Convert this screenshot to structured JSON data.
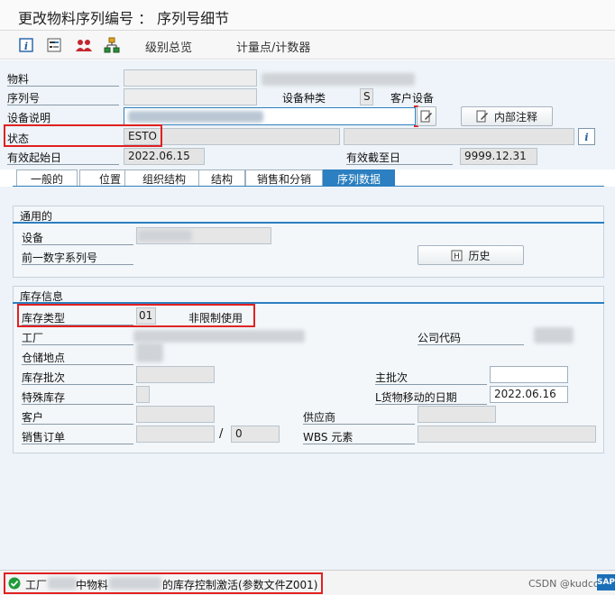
{
  "window": {
    "title": "更改物料序列编号 ： 序列号细节"
  },
  "toolbar": {
    "icons": [
      "info-icon",
      "structure-icon",
      "partners-icon",
      "hierarchy-icon"
    ],
    "overview_label": "级别总览",
    "counter_label": "计量点/计数器"
  },
  "header": {
    "material_label": "物料",
    "serial_label": "序列号",
    "equip_category_label": "设备种类",
    "equip_category_value": "S",
    "equip_category_text": "客户设备",
    "description_label": "设备说明",
    "internal_note_label": "内部注释",
    "status_label": "状态",
    "status_value": "ESTO",
    "valid_from_label": "有效起始日",
    "valid_from_value": "2022.06.15",
    "valid_to_label": "有效截至日",
    "valid_to_value": "9999.12.31"
  },
  "tabs": [
    {
      "label": "一般的"
    },
    {
      "label": "位置"
    },
    {
      "label": "组织结构"
    },
    {
      "label": "结构"
    },
    {
      "label": "销售和分销"
    },
    {
      "label": "序列数据"
    }
  ],
  "general_group": {
    "title": "通用的",
    "equipment_label": "设备",
    "prev_serial_label": "前一数字系列号",
    "history_button": "历史"
  },
  "stock_group": {
    "title": "库存信息",
    "stock_type_label": "库存类型",
    "stock_type_value": "01",
    "stock_type_text": "非限制使用",
    "plant_label": "工厂",
    "company_code_label": "公司代码",
    "storage_location_label": "仓储地点",
    "stock_batch_label": "库存批次",
    "master_batch_label": "主批次",
    "special_stock_label": "特殊库存",
    "last_movement_label": "L货物移动的日期",
    "last_movement_value": "2022.06.16",
    "customer_label": "客户",
    "vendor_label": "供应商",
    "sales_order_label": "销售订单",
    "sales_order_item": "0",
    "slash": "/",
    "wbs_label": "WBS 元素"
  },
  "status_bar": {
    "part1": "工厂",
    "part2": "中物料",
    "part3": "的库存控制激活(参数文件Z001)",
    "watermark": "CSDN @kudcon",
    "logo_text": "SAP"
  },
  "colors": {
    "accent": "#2c7fc0",
    "highlight_red": "#e02020",
    "success_green": "#1e9b3a"
  }
}
